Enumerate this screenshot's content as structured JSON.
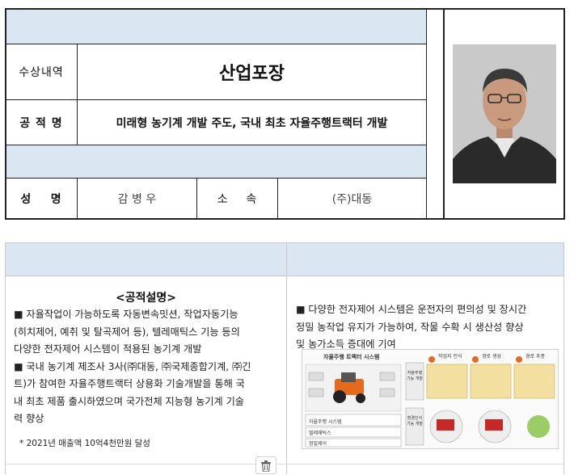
{
  "award": {
    "label_award": "수상내역",
    "award_name": "산업포장",
    "label_achievement": "공 적 명",
    "achievement_title": "미래형 농기계 개발 주도, 국내 최초 자율주행트랙터 개발",
    "label_name": "성    명",
    "person_name": "감 병 우",
    "label_affiliation": "소    속",
    "affiliation": "(주)대동"
  },
  "description": {
    "heading": "<공적설명>",
    "left_paragraphs": [
      "■ 자율작업이 가능하도록 자동변속밋션, 작업자동기능",
      "(히치제어, 예취 및 탈곡제어 등), 텔레매틱스 기능 등의",
      "다양한 전자제어 시스템이 적용된 농기계 개발",
      "■ 국내 농기계 제조사 3사(㈜대동, ㈜국제종합기계, ㈜긴",
      "트)가 참여한 자율주행트랙터 상용화 기술개발을 통해 국",
      "내 최초 제품 출시하였으며 국가전체 지능형 농기계 기술",
      "력 향상"
    ],
    "note": "* 2021년 매출액 10억4천만원 달성",
    "right_paragraphs": [
      "■ 다양한 전자제어 시스템은 운전자의 편의성 및 장시간",
      "정밀 농작업 유지가 가능하여, 작물 수확 시 생산성 향상",
      "및 농가소득 증대에 기여"
    ],
    "diagram": {
      "title": "자율주행 트랙터 시스템",
      "steps": [
        "작업지 인식",
        "경로 생성",
        "경로 추종"
      ],
      "side_labels": [
        "자율주행 기능 개발",
        "환경인식 기능 개발"
      ],
      "blocks": [
        "자율주행 시스템",
        "텔레매틱스",
        "정밀제어"
      ]
    }
  },
  "icons": {
    "delete": "trash-icon"
  }
}
